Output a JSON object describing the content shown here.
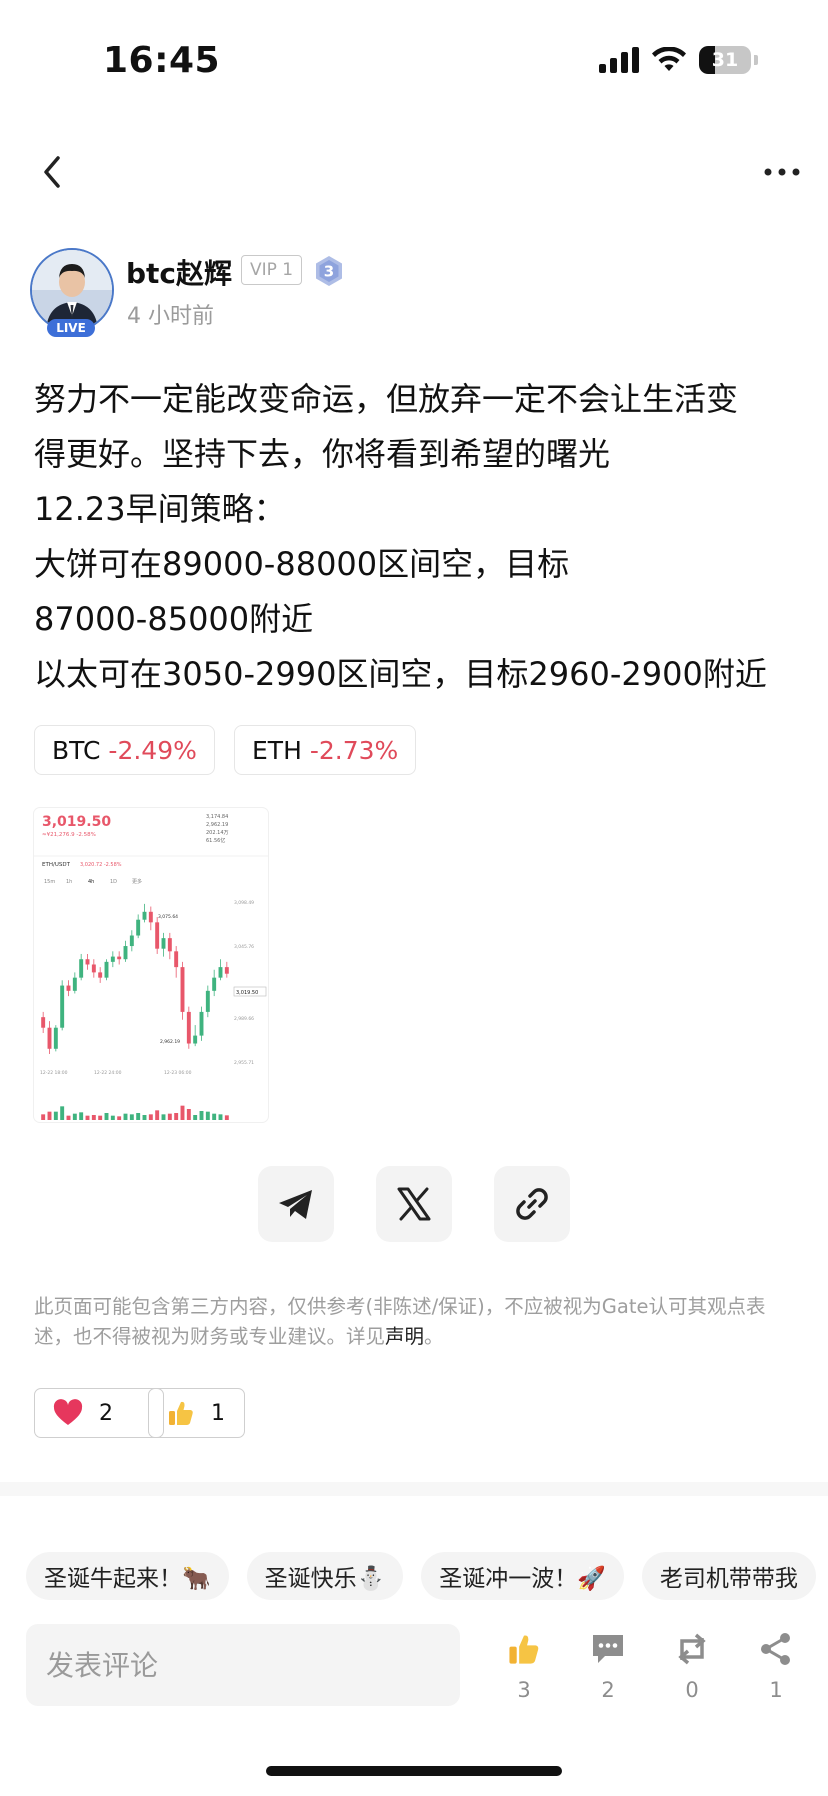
{
  "status_bar": {
    "time": "16:45",
    "battery": "31",
    "battery_level": 0.31
  },
  "author": {
    "name": "btc赵辉",
    "vip": "VIP 1",
    "level": "3",
    "live": "LIVE",
    "posted": "4 小时前"
  },
  "post": {
    "lines": [
      "努力不一定能改变命运，但放弃一定不会让生活变",
      "得更好。坚持下去，你将看到希望的曙光",
      "12.23早间策略：",
      "大饼可在89000-88000区间空，目标",
      "87000-85000附近",
      "以太可在3050-2990区间空，目标2960-2900附近"
    ]
  },
  "tickers": [
    {
      "symbol": "BTC",
      "change": "-2.49%"
    },
    {
      "symbol": "ETH",
      "change": "-2.73%"
    }
  ],
  "chart_thumb": {
    "price": "3,019.50",
    "sub": "≈¥21,276.9  -2.58%",
    "pair": "ETH/USDT",
    "pair_price": "3,020.72 -2.58%",
    "stats": [
      "3,174.84",
      "2,962.19",
      "202.14万",
      "61.56亿"
    ],
    "tabs": [
      "15m",
      "1h",
      "4h",
      "1D",
      "更多"
    ],
    "price_tag": "3,019.50",
    "high_label": "3,075.64",
    "low_label": "2,962.19",
    "ticks": [
      "3,098.49",
      "3,045.76",
      "2,989.66",
      "2,955.71"
    ],
    "dates": [
      "12-22 18:00",
      "12-22 24:00",
      "12-23 06:00"
    ],
    "colors": {
      "up": "#3fb37f",
      "down": "#e8576a"
    },
    "candles": [
      [
        2986,
        2978,
        2990,
        2974
      ],
      [
        2978,
        2962,
        2983,
        2958
      ],
      [
        2962,
        2978,
        2980,
        2960
      ],
      [
        2978,
        3010,
        3014,
        2976
      ],
      [
        3010,
        3006,
        3014,
        3002
      ],
      [
        3006,
        3016,
        3020,
        3004
      ],
      [
        3016,
        3030,
        3034,
        3014
      ],
      [
        3030,
        3026,
        3034,
        3022
      ],
      [
        3026,
        3020,
        3030,
        3016
      ],
      [
        3020,
        3016,
        3024,
        3012
      ],
      [
        3016,
        3028,
        3030,
        3014
      ],
      [
        3028,
        3032,
        3036,
        3024
      ],
      [
        3032,
        3030,
        3036,
        3026
      ],
      [
        3030,
        3040,
        3044,
        3028
      ],
      [
        3040,
        3048,
        3052,
        3036
      ],
      [
        3048,
        3060,
        3064,
        3046
      ],
      [
        3060,
        3066,
        3072,
        3058
      ],
      [
        3066,
        3058,
        3070,
        3052
      ],
      [
        3058,
        3038,
        3062,
        3034
      ],
      [
        3038,
        3046,
        3050,
        3032
      ],
      [
        3046,
        3036,
        3050,
        3030
      ],
      [
        3036,
        3024,
        3040,
        3016
      ],
      [
        3024,
        2990,
        3028,
        2984
      ],
      [
        2990,
        2966,
        2994,
        2962
      ],
      [
        2966,
        2972,
        2980,
        2964
      ],
      [
        2972,
        2990,
        2994,
        2968
      ],
      [
        2990,
        3006,
        3010,
        2986
      ],
      [
        3006,
        3016,
        3022,
        3002
      ],
      [
        3016,
        3024,
        3030,
        3014
      ],
      [
        3024,
        3019,
        3028,
        3016
      ]
    ],
    "ylim": [
      2955,
      3078
    ]
  },
  "share": {
    "icons": [
      "telegram-icon",
      "x-icon",
      "link-icon"
    ]
  },
  "disclaimer": {
    "text": "此页面可能包含第三方内容，仅供参考(非陈述/保证)，不应被视为Gate认可其观点表述，也不得被视为财务或专业建议。详见",
    "link": "声明",
    "end": "。"
  },
  "reactions": [
    {
      "icon": "heart-icon",
      "count": "2"
    },
    {
      "icon": "thumbs-up-icon",
      "count": "1"
    }
  ],
  "quick_comments": [
    "圣诞牛起来！🐂",
    "圣诞快乐⛄",
    "圣诞冲一波！🚀",
    "老司机带带我"
  ],
  "bottom_bar": {
    "placeholder": "发表评论",
    "likes": "3",
    "comments": "2",
    "reposts": "0",
    "shares": "1"
  }
}
